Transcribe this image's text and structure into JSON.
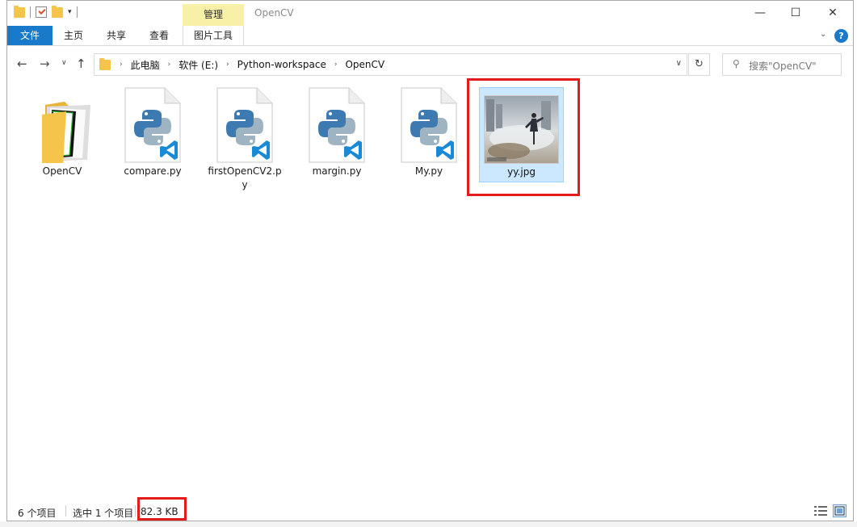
{
  "window": {
    "title": "OpenCV",
    "context_tab": "管理",
    "controls": {
      "minimize": "—",
      "maximize": "☐",
      "close": "✕"
    }
  },
  "ribbon": {
    "tabs": [
      "文件",
      "主页",
      "共享",
      "查看",
      "图片工具"
    ],
    "help": "?"
  },
  "address": {
    "breadcrumbs": [
      "此电脑",
      "软件 (E:)",
      "Python-workspace",
      "OpenCV"
    ],
    "search_placeholder": "搜索\"OpenCV\""
  },
  "files": [
    {
      "name": "OpenCV",
      "type": "folder"
    },
    {
      "name": "compare.py",
      "type": "python"
    },
    {
      "name": "firstOpenCV2.py",
      "type": "python"
    },
    {
      "name": "margin.py",
      "type": "python"
    },
    {
      "name": "My.py",
      "type": "python"
    },
    {
      "name": "yy.jpg",
      "type": "image",
      "selected": true
    }
  ],
  "status": {
    "item_count": "6 个项目",
    "selected": "选中 1 个项目",
    "size": "82.3 KB"
  },
  "colors": {
    "accent": "#1979ca",
    "manage_tab": "#f7f0a6",
    "selection": "#cce8ff",
    "highlight": "#e31b1b"
  }
}
